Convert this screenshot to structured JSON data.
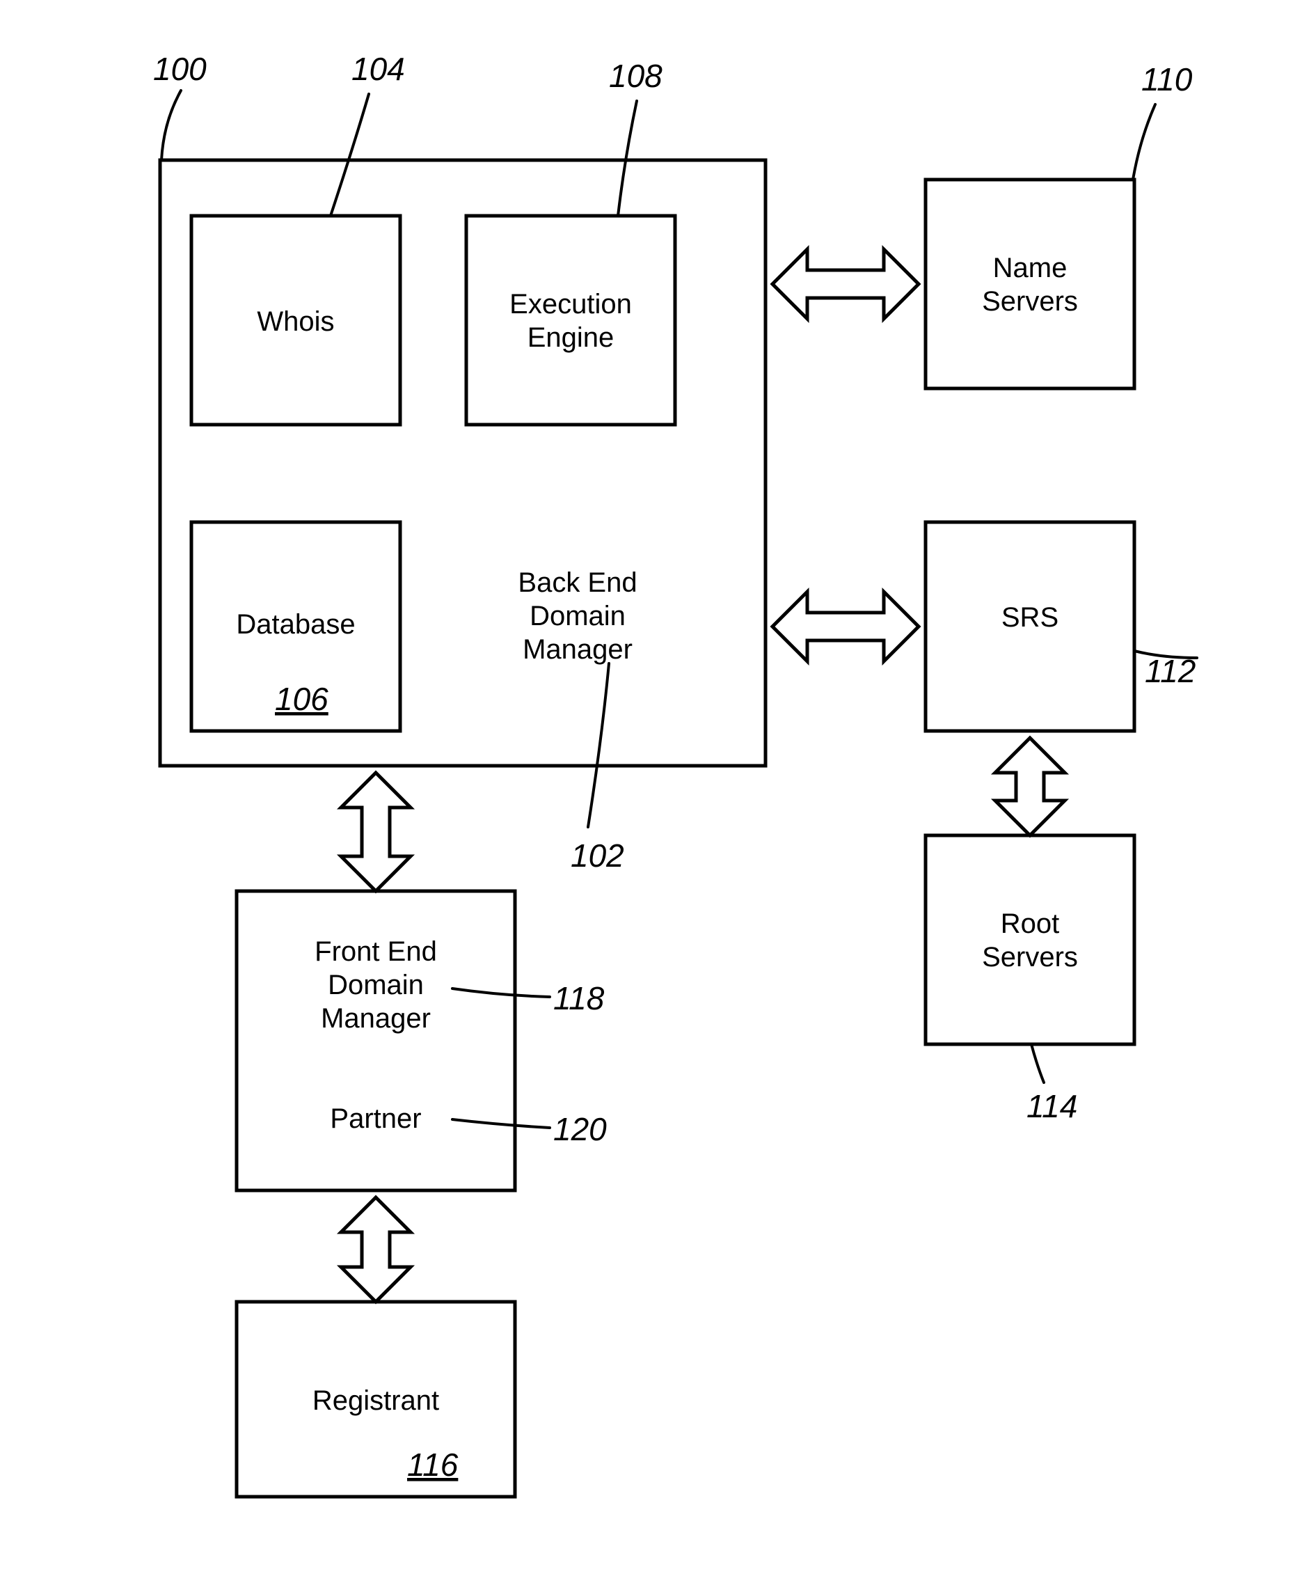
{
  "boxes": {
    "whois": "Whois",
    "exec1": "Execution",
    "exec2": "Engine",
    "database": "Database",
    "bedm1": "Back End",
    "bedm2": "Domain",
    "bedm3": "Manager",
    "nameservers1": "Name",
    "nameservers2": "Servers",
    "srs": "SRS",
    "root1": "Root",
    "root2": "Servers",
    "fedm1": "Front End",
    "fedm2": "Domain",
    "fedm3": "Manager",
    "partner": "Partner",
    "registrant": "Registrant"
  },
  "refs": {
    "r100": "100",
    "r104": "104",
    "r108": "108",
    "r110": "110",
    "r106": "106",
    "r102": "102",
    "r112": "112",
    "r114": "114",
    "r118": "118",
    "r120": "120",
    "r116": "116"
  }
}
